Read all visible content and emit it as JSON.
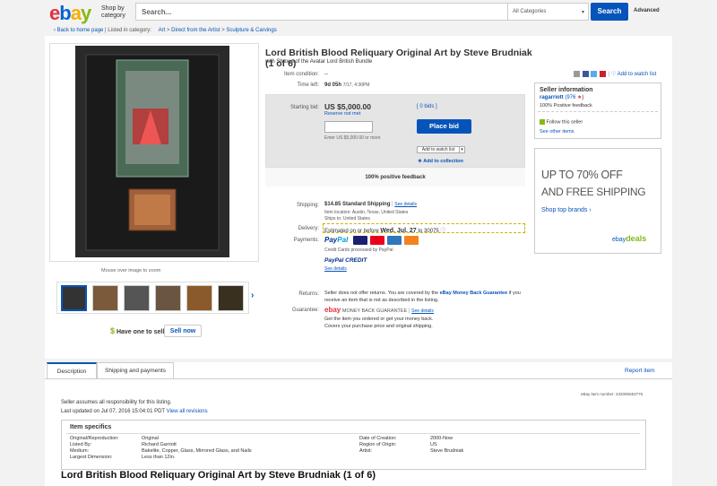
{
  "header": {
    "shop_by_category": "Shop by category",
    "search_placeholder": "Search...",
    "category_select": "All Categories",
    "search_button": "Search",
    "advanced": "Advanced"
  },
  "breadcrumb": {
    "back": "Back to home page",
    "listed_in": "Listed in category:",
    "items": [
      "Art",
      "Direct from the Artist",
      "Sculpture & Carvings"
    ]
  },
  "listing": {
    "title": "Lord British Blood Reliquary Original Art by Steve Brudniak (1 of 6)",
    "subtitle": "with Shroud of the Avatar Lord British Bundle",
    "mouseover": "Mouse over image to zoom",
    "condition_label": "Item condition:",
    "condition_value": "--",
    "time_left_label": "Time left:",
    "time_left_value": "9d 05h",
    "time_left_detail": "7/17, 4:30PM",
    "starting_bid_label": "Starting bid:",
    "starting_bid_value": "US $5,000.00",
    "reserve": "Reserve not met",
    "bids": "[ 0 bids ]",
    "bid_hint": "Enter US $5,000.00 or more",
    "place_bid": "Place bid",
    "add_to_watch": "Add to watch list",
    "add_to_collection": "Add to collection",
    "positive_feedback": "100% positive feedback",
    "shipping_label": "Shipping:",
    "shipping_cost": "$14.85",
    "shipping_method": "Standard Shipping",
    "see_details": "See details",
    "item_location": "Item location: Austin, Texas, United States",
    "ships_to": "Ships to: United States",
    "delivery_label": "Delivery:",
    "delivery_text": "Estimated on or before",
    "delivery_date": "Wed. Jul. 27",
    "delivery_to": "to 30075",
    "payments_label": "Payments:",
    "paypal_pay": "Pay",
    "paypal_pal": "Pal",
    "credit_cards_note": "Credit Cards processed by PayPal",
    "paypal_credit": "PayPal CREDIT",
    "returns_label": "Returns:",
    "returns_text_1": "Seller does not offer returns. You are covered by the",
    "returns_link": "eBay Money Back",
    "returns_text_2": "Guarantee",
    "returns_text_3": "if you receive an item that is not as described in the listing.",
    "guarantee_label": "Guarantee:",
    "guarantee_brand": "ebay",
    "guarantee_text": "MONEY BACK GUARANTEE",
    "guarantee_line1": "Get the item you ordered or get your money back.",
    "guarantee_line2": "Covers your purchase price and original shipping.",
    "have_one": "Have one to sell?",
    "sell_now": "Sell now"
  },
  "seller": {
    "heading": "Seller information",
    "name": "ragarriott",
    "score": "(976",
    "feedback": "100% Positive feedback",
    "follow": "Follow this seller",
    "see_other": "See other items"
  },
  "share_links": {
    "add_to_watch": "Add to watch list"
  },
  "ad": {
    "line1": "UP TO",
    "pct": "70% OFF",
    "line2": "AND FREE SHIPPING",
    "cta": "Shop top brands",
    "brand_ebay": "ebay",
    "brand_deals": "deals"
  },
  "tabs": {
    "description": "Description",
    "shipping": "Shipping and payments",
    "report": "Report item"
  },
  "description": {
    "item_number_label": "eBay item number:",
    "item_number": "232005553776",
    "responsibility": "Seller assumes all responsibility for this listing.",
    "last_updated_label": "Last updated on",
    "last_updated": "Jul 07, 2016 15:04:01 PDT",
    "view_revisions": "View all revisions",
    "specifics_heading": "Item specifics",
    "specifics_left": [
      {
        "k": "Original/Reproduction:",
        "v": "Original"
      },
      {
        "k": "Listed By:",
        "v": "Richard Garriott"
      },
      {
        "k": "Medium:",
        "v": "Bakelite, Copper, Glass, Mirrored Glass, and Nails"
      },
      {
        "k": "Largest Dimension:",
        "v": "Less than 12in."
      }
    ],
    "specifics_right": [
      {
        "k": "Date of Creation:",
        "v": "2000-Now"
      },
      {
        "k": "Region of Origin:",
        "v": "US"
      },
      {
        "k": "Artist:",
        "v": "Steve Brudniak"
      }
    ],
    "big_title": "Lord British Blood Reliquary Original Art by Steve Brudniak (1 of 6)"
  },
  "colors": {
    "link": "#0654ba",
    "button": "#0654ba",
    "deals_green": "#86b817"
  }
}
